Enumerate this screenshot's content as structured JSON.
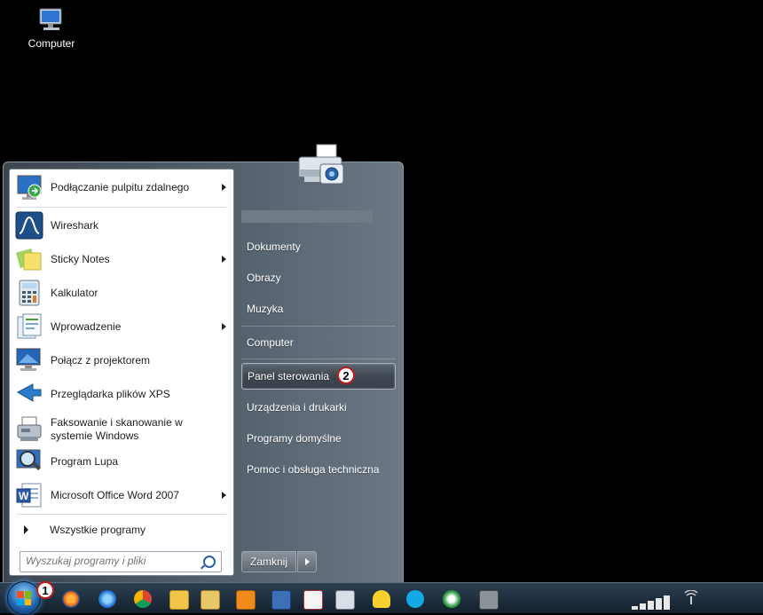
{
  "desktop": {
    "computer_label": "Computer"
  },
  "start_menu": {
    "programs": [
      {
        "label": "Podłączanie pulpitu zdalnego",
        "has_submenu": true,
        "icon": "remote-desktop-icon"
      },
      {
        "label": "Wireshark",
        "has_submenu": false,
        "icon": "wireshark-icon"
      },
      {
        "label": "Sticky Notes",
        "has_submenu": true,
        "icon": "sticky-notes-icon"
      },
      {
        "label": "Kalkulator",
        "has_submenu": false,
        "icon": "calculator-icon"
      },
      {
        "label": "Wprowadzenie",
        "has_submenu": true,
        "icon": "getting-started-icon"
      },
      {
        "label": "Połącz z projektorem",
        "has_submenu": false,
        "icon": "projector-icon"
      },
      {
        "label": "Przeglądarka plików XPS",
        "has_submenu": false,
        "icon": "xps-viewer-icon"
      },
      {
        "label": "Faksowanie i skanowanie w systemie Windows",
        "has_submenu": false,
        "icon": "fax-scan-icon"
      },
      {
        "label": "Program Lupa",
        "has_submenu": false,
        "icon": "magnifier-icon"
      },
      {
        "label": "Microsoft Office Word 2007",
        "has_submenu": true,
        "icon": "word-icon"
      }
    ],
    "all_programs": "Wszystkie programy",
    "search_placeholder": "Wyszukaj programy i pliki",
    "right_items": [
      {
        "label": "Dokumenty"
      },
      {
        "label": "Obrazy"
      },
      {
        "label": "Muzyka"
      },
      {
        "label": "Computer"
      },
      {
        "label": "Panel sterowania",
        "highlighted": true
      },
      {
        "label": "Urządzenia i drukarki"
      },
      {
        "label": "Programy domyślne"
      },
      {
        "label": "Pomoc i obsługa techniczna"
      }
    ],
    "shutdown_label": "Zamknij"
  },
  "annotations": {
    "badge_start": "1",
    "badge_control_panel": "2"
  },
  "taskbar": {
    "icons": [
      "firefox-icon",
      "ie-icon",
      "chrome-icon",
      "outlook-icon",
      "explorer-icon",
      "media-player-icon",
      "network-icon",
      "paint-icon",
      "app-icon",
      "vlc-icon",
      "skype-icon",
      "kmplayer-icon",
      "tool-icon",
      "calculator-icon"
    ],
    "accent": "#1c5fa8"
  }
}
